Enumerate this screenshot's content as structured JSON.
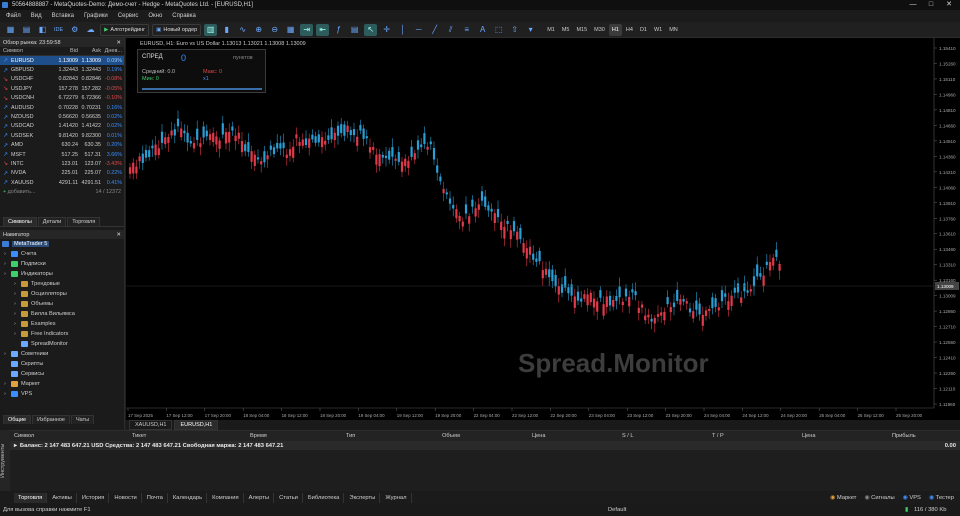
{
  "window": {
    "title": "50564888887 - MetaQuotes-Demo: Демо-счет - Hedge - MetaQuotes Ltd. - [EURUSD,H1]"
  },
  "menu": [
    "Файл",
    "Вид",
    "Вставка",
    "Графики",
    "Сервис",
    "Окно",
    "Справка"
  ],
  "toolbar": {
    "algo_label": "Алготрейдинг",
    "neworder_label": "Новый ордер",
    "ide_label": "IDE",
    "timeframes": [
      "M1",
      "M5",
      "M15",
      "M30",
      "H1",
      "H4",
      "D1",
      "W1",
      "MN"
    ],
    "active_tf": "H1"
  },
  "market_watch": {
    "title": "Обзор рынка: 23:59:58",
    "headers": [
      "Символ",
      "Bid",
      "Ask",
      "Днев..."
    ],
    "rows": [
      {
        "sym": "EURUSD",
        "bid": "1.13009",
        "ask": "1.13009",
        "chg": "0.09%",
        "dir": "up",
        "sel": true
      },
      {
        "sym": "GBPUSD",
        "bid": "1.32443",
        "ask": "1.32443",
        "chg": "0.19%",
        "dir": "up"
      },
      {
        "sym": "USDCHF",
        "bid": "0.82843",
        "ask": "0.82846",
        "chg": "-0.08%",
        "dir": "dn"
      },
      {
        "sym": "USDJPY",
        "bid": "157.278",
        "ask": "157.282",
        "chg": "-0.05%",
        "dir": "dn"
      },
      {
        "sym": "USDCNH",
        "bid": "6.72279",
        "ask": "6.72366",
        "chg": "-0.10%",
        "dir": "dn"
      },
      {
        "sym": "AUDUSD",
        "bid": "0.70228",
        "ask": "0.70231",
        "chg": "0.16%",
        "dir": "up"
      },
      {
        "sym": "NZDUSD",
        "bid": "0.56620",
        "ask": "0.56635",
        "chg": "0.02%",
        "dir": "up"
      },
      {
        "sym": "USDCAD",
        "bid": "1.41420",
        "ask": "1.41422",
        "chg": "0.02%",
        "dir": "up"
      },
      {
        "sym": "USDSEK",
        "bid": "9.81420",
        "ask": "9.82300",
        "chg": "0.01%",
        "dir": "up"
      },
      {
        "sym": "AMD",
        "bid": "630.24",
        "ask": "630.35",
        "chg": "0.20%",
        "dir": "up"
      },
      {
        "sym": "MSFT",
        "bid": "517.25",
        "ask": "517.31",
        "chg": "3.66%",
        "dir": "up"
      },
      {
        "sym": "INTC",
        "bid": "123.01",
        "ask": "123.07",
        "chg": "-3.43%",
        "dir": "dn"
      },
      {
        "sym": "NVDA",
        "bid": "225.01",
        "ask": "225.07",
        "chg": "0.22%",
        "dir": "up"
      },
      {
        "sym": "XAUUSD",
        "bid": "4291.11",
        "ask": "4291.51",
        "chg": "0.41%",
        "dir": "up"
      }
    ],
    "add_label": "добавить...",
    "count": "14 / 12372",
    "tabs": [
      "Символы",
      "Детали",
      "Торговля"
    ]
  },
  "navigator": {
    "title": "Навигатор",
    "root": "MetaTrader 5",
    "items": [
      {
        "label": "Счета",
        "lvl": 1
      },
      {
        "label": "Подписки",
        "lvl": 1
      },
      {
        "label": "Индикаторы",
        "lvl": 1
      },
      {
        "label": "Трендовые",
        "lvl": 2
      },
      {
        "label": "Осцилляторы",
        "lvl": 2
      },
      {
        "label": "Объемы",
        "lvl": 2
      },
      {
        "label": "Билла Вильямса",
        "lvl": 2
      },
      {
        "label": "Examples",
        "lvl": 2
      },
      {
        "label": "Free Indicators",
        "lvl": 2
      },
      {
        "label": "SpreadMonitor",
        "lvl": 2
      },
      {
        "label": "Советники",
        "lvl": 1
      },
      {
        "label": "Скрипты",
        "lvl": 1
      },
      {
        "label": "Сервисы",
        "lvl": 1
      },
      {
        "label": "Маркет",
        "lvl": 1
      },
      {
        "label": "VPS",
        "lvl": 1
      }
    ],
    "tabs": [
      "Общие",
      "Избранное",
      "Чаты"
    ]
  },
  "chart": {
    "header": "EURUSD, H1:  Euro vs US Dollar  1.13013 1.13021 1.13008 1.13009",
    "watermark": "Spread.Monitor",
    "price_labels": [
      "1.15410",
      "1.15260",
      "1.15110",
      "1.14960",
      "1.14810",
      "1.14660",
      "1.14510",
      "1.14360",
      "1.14210",
      "1.14060",
      "1.13910",
      "1.13760",
      "1.13610",
      "1.13460",
      "1.13310",
      "1.13160",
      "1.13009",
      "1.12860",
      "1.12710",
      "1.12560",
      "1.12410",
      "1.12260",
      "1.12110",
      "1.11960"
    ],
    "current_price": "1.13009",
    "time_labels": [
      "17 Sep 2025",
      "17 Sep 12:00",
      "17 Sep 20:00",
      "18 Sep 04:00",
      "18 Sep 12:00",
      "18 Sep 20:00",
      "19 Sep 04:00",
      "19 Sep 12:00",
      "19 Sep 20:00",
      "22 Sep 04:00",
      "22 Sep 12:00",
      "22 Sep 20:00",
      "23 Sep 04:00",
      "23 Sep 12:00",
      "23 Sep 20:00",
      "24 Sep 04:00",
      "24 Sep 12:00",
      "24 Sep 20:00",
      "25 Sep 04:00",
      "25 Sep 12:00",
      "25 Sep 20:00"
    ]
  },
  "spread_panel": {
    "label": "СПРЕД",
    "value": "0",
    "unit": "пунктов",
    "avg": "Средний: 0.0",
    "max": "Макс: 0",
    "min": "Мин: 0",
    "ratio": "x1"
  },
  "chart_tabs": [
    "XAUUSD,H1",
    "EURUSD,H1"
  ],
  "toolbox": {
    "headers": [
      "Символ",
      "Тикет",
      "Время",
      "Тип",
      "Объем",
      "Цена",
      "S / L",
      "T / P",
      "Цена",
      "Прибыль"
    ],
    "balance": "Баланс: 2 147 483 647.21 USD  Средства: 2 147 483 647.21  Свободная маржа: 2 147 483 647.21",
    "profit": "0.00",
    "vertical": "Инструменты"
  },
  "bottom_tabs": [
    "Торговля",
    "Активы",
    "История",
    "Новости",
    "Почта",
    "Календарь",
    "Компания",
    "Алерты",
    "Статьи",
    "Библиотека",
    "Эксперты",
    "Журнал"
  ],
  "bottom_right": [
    "Маркет",
    "Сигналы",
    "VPS",
    "Тестер"
  ],
  "status": {
    "left": "Для вызова справки нажмите F1",
    "center": "Default",
    "right": "116 / 380 Kb"
  }
}
